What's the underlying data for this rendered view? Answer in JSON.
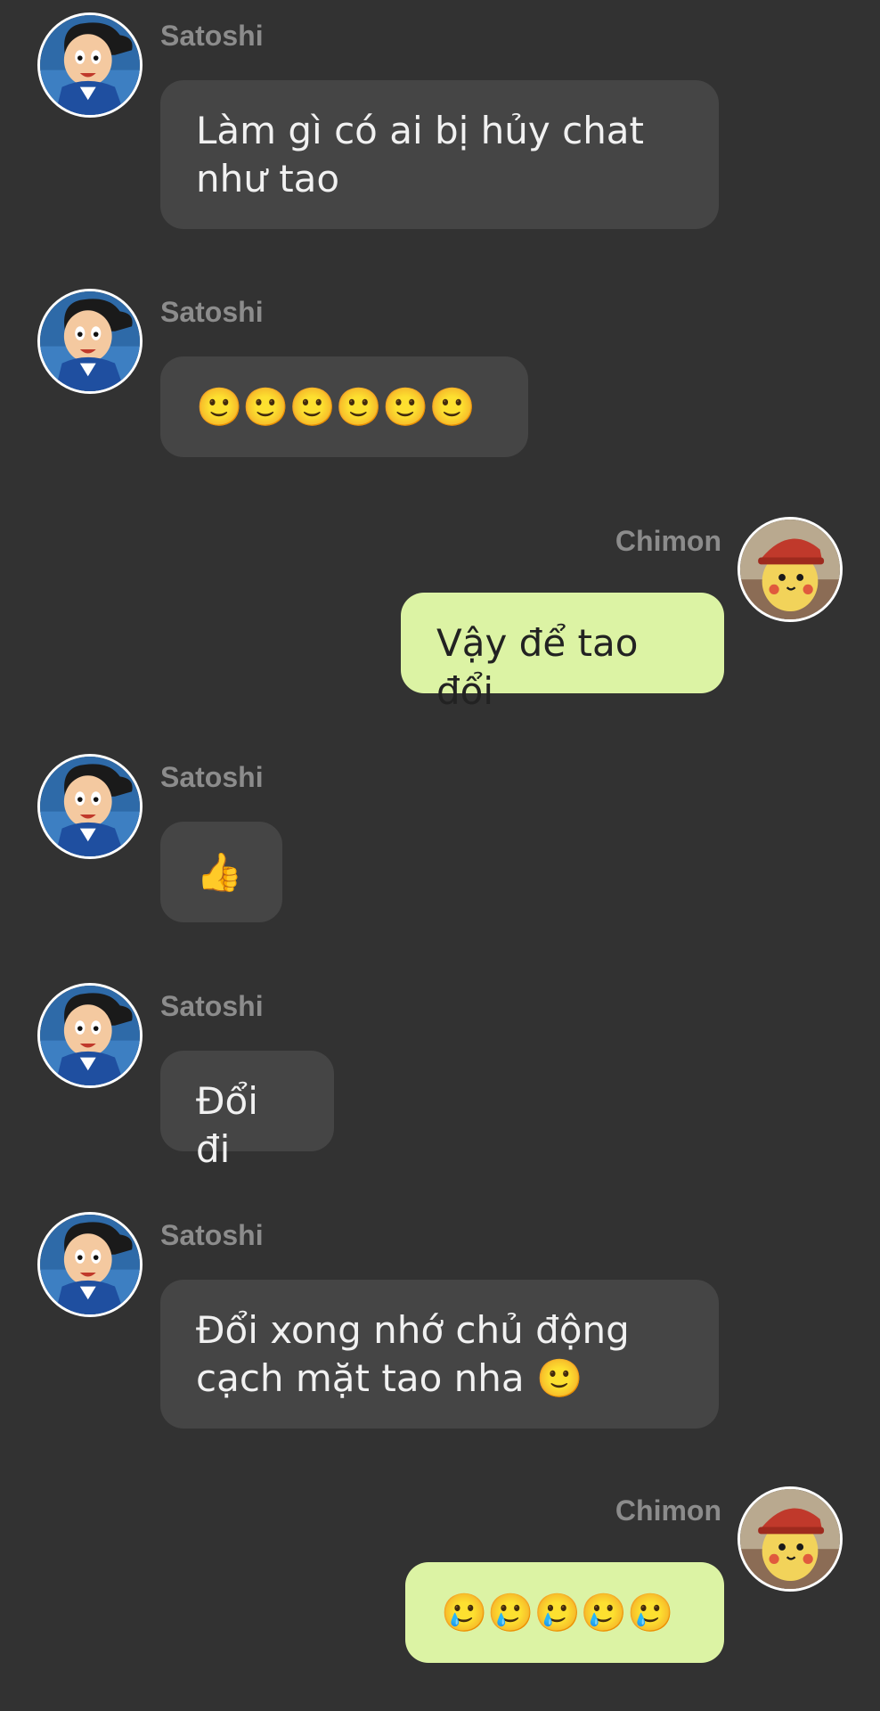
{
  "messages": [
    {
      "sender": "Satoshi",
      "text": "Làm gì có ai bị hủy chat\nnhư tao"
    },
    {
      "sender": "Satoshi",
      "text": "🙂🙂🙂🙂🙂🙂"
    },
    {
      "sender": "Chimon",
      "text": "Vậy để tao đổi"
    },
    {
      "sender": "Satoshi",
      "text": "👍"
    },
    {
      "sender": "Satoshi",
      "text": "Đổi đi"
    },
    {
      "sender": "Satoshi",
      "text": "Đổi xong nhớ chủ động\ncạch mặt tao nha 🙂"
    },
    {
      "sender": "Chimon",
      "text": "🥲🥲🥲🥲🥲"
    }
  ],
  "colors": {
    "background": "#323232",
    "incoming_bubble": "#454545",
    "outgoing_bubble": "#dcf3a4",
    "sender_name": "#8c8c8c"
  },
  "icons": {
    "satoshi_avatar": "ash-cartoon-avatar-icon",
    "chimon_avatar": "pikachu-cap-avatar-icon"
  }
}
